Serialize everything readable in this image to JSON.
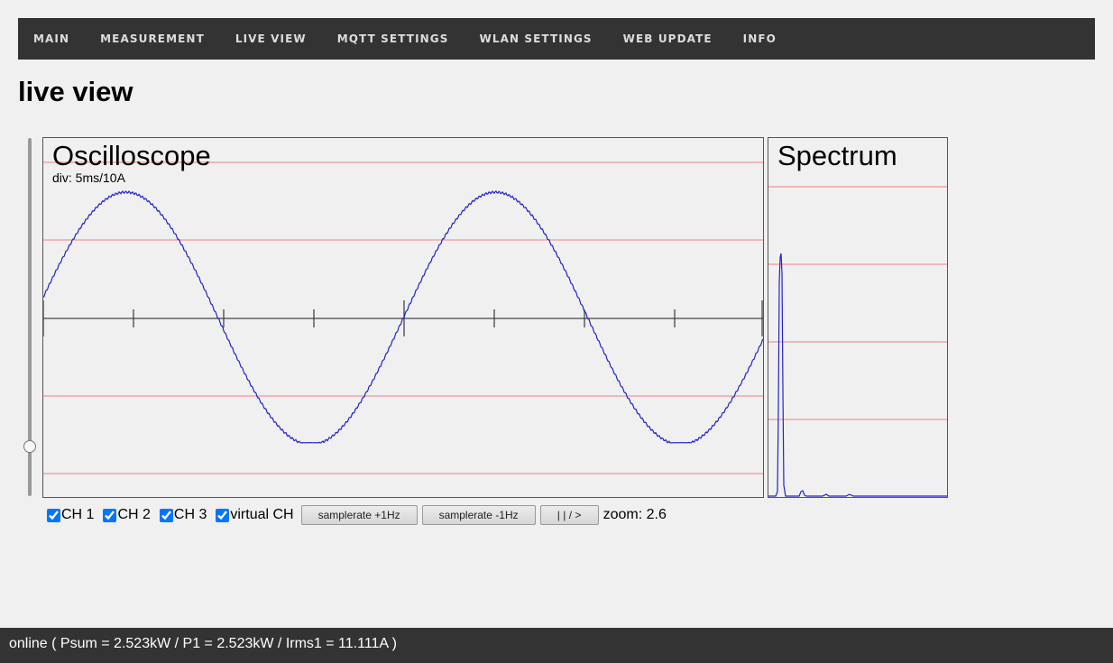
{
  "nav": {
    "items": [
      "MAIN",
      "MEASUREMENT",
      "LIVE VIEW",
      "MQTT SETTINGS",
      "WLAN SETTINGS",
      "WEB UPDATE",
      "INFO"
    ]
  },
  "page": {
    "title": "live view"
  },
  "oscilloscope": {
    "title": "Oscilloscope",
    "div_label": "div: 5ms/10A"
  },
  "spectrum": {
    "title": "Spectrum"
  },
  "controls": {
    "channels": [
      {
        "label": "CH 1",
        "checked": true
      },
      {
        "label": "CH 2",
        "checked": true
      },
      {
        "label": "CH 3",
        "checked": true
      },
      {
        "label": "virtual CH",
        "checked": true
      }
    ],
    "btn_plus": "samplerate +1Hz",
    "btn_minus": "samplerate -1Hz",
    "btn_pause": "| | / >",
    "zoom": "zoom: 2.6"
  },
  "status": "online ( Psum = 2.523kW / P1 = 2.523kW / Irms1 = 11.111A )",
  "colors": {
    "trace": "#2222cc",
    "grid": "#f08080",
    "axis": "#444444",
    "bar": "#333333"
  }
}
